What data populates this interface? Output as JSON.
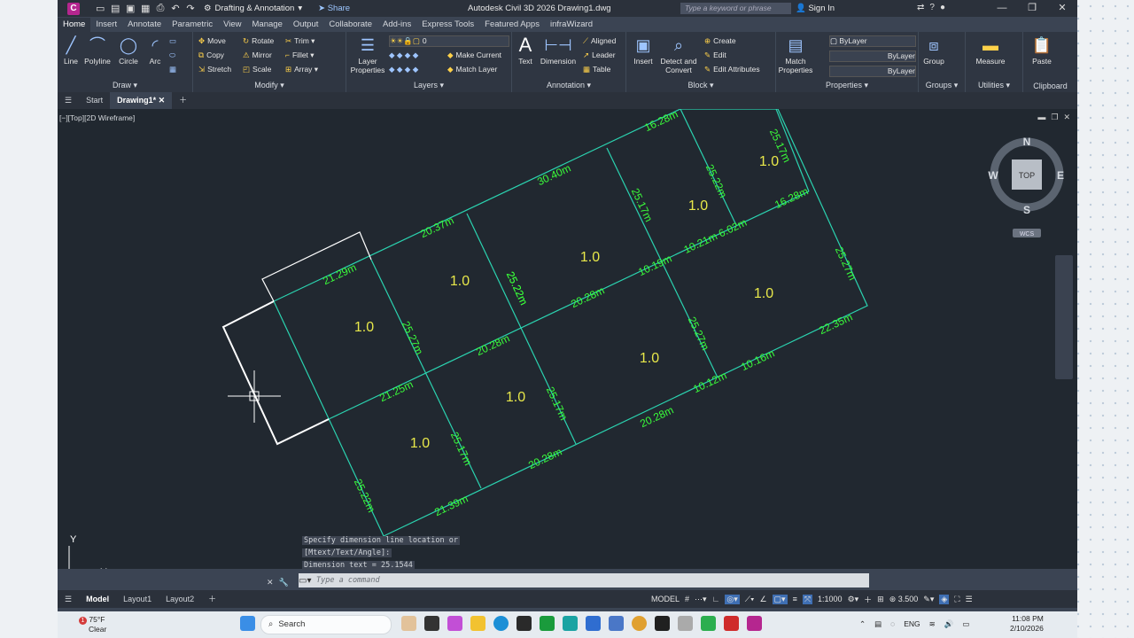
{
  "title_bar": {
    "app_logo": "C",
    "workspace": "Drafting & Annotation",
    "share": "Share",
    "title": "Autodesk Civil 3D 2026    Drawing1.dwg",
    "search_placeholder": "Type a keyword or phrase",
    "sign_in": "Sign In"
  },
  "ribbon_tabs": [
    "Home",
    "Insert",
    "Annotate",
    "Parametric",
    "View",
    "Manage",
    "Output",
    "Collaborate",
    "Add-ins",
    "Express Tools",
    "Featured Apps",
    "infraWizard"
  ],
  "ribbon": {
    "draw": {
      "label": "Draw",
      "line": "Line",
      "polyline": "Polyline",
      "circle": "Circle",
      "arc": "Arc"
    },
    "modify": {
      "label": "Modify",
      "move": "Move",
      "rotate": "Rotate",
      "trim": "Trim",
      "copy": "Copy",
      "mirror": "Mirror",
      "fillet": "Fillet",
      "stretch": "Stretch",
      "scale": "Scale",
      "array": "Array"
    },
    "layers": {
      "label": "Layers",
      "layer_properties": "Layer Properties",
      "layer_value": "0",
      "make_current": "Make Current",
      "match_layer": "Match Layer"
    },
    "annotation": {
      "label": "Annotation",
      "text": "Text",
      "dimension": "Dimension",
      "aligned": "Aligned",
      "leader": "Leader",
      "table": "Table"
    },
    "block": {
      "label": "Block",
      "insert": "Insert",
      "detect": "Detect and Convert",
      "create": "Create",
      "edit": "Edit",
      "edit_attributes": "Edit Attributes"
    },
    "properties": {
      "label": "Properties",
      "match": "Match Properties",
      "bylayer1": "ByLayer",
      "bylayer2": "ByLayer",
      "bylayer3": "ByLayer"
    },
    "groups": {
      "label": "Groups",
      "group": "Group"
    },
    "utilities": {
      "label": "Utilities",
      "measure": "Measure"
    },
    "clipboard": {
      "label": "Clipboard",
      "paste": "Paste"
    }
  },
  "doc_tabs": {
    "start": "Start",
    "drawing": "Drawing1*"
  },
  "viewport": {
    "label": "[−][Top][2D Wireframe]"
  },
  "viewcube": {
    "n": "N",
    "s": "S",
    "e": "E",
    "w": "W",
    "top": "TOP",
    "wcs": "WCS"
  },
  "drawing": {
    "lot_labels": [
      "1.0",
      "1.0",
      "1.0",
      "1.0",
      "1.0",
      "1.0",
      "1.0",
      "1.0",
      "1.0",
      "1.0"
    ],
    "dims": [
      "16.28m",
      "30.40m",
      "25.17m",
      "25.22m",
      "20.37m",
      "25.17m",
      "16.28m",
      "25.22m",
      "1.0",
      "21.29m",
      "25.22m",
      "10.21m 6.02m",
      "10.19m",
      "20.28m",
      "25.27m",
      "25.27m",
      "20.28m",
      "22.35m",
      "25.27m",
      "21.25m",
      "25.17m",
      "10.16m",
      "10.12m",
      "25.17m",
      "20.28m",
      "20.28m",
      "25.22m",
      "21.39m"
    ]
  },
  "axis": {
    "y": "Y",
    "x": "X"
  },
  "command": {
    "history": [
      "Specify dimension line location or",
      "[Mtext/Text/Angle]:",
      "Dimension text = 25.1544"
    ],
    "placeholder": "Type a command"
  },
  "status_bar": {
    "tabs": [
      "Model",
      "Layout1",
      "Layout2"
    ],
    "model": "MODEL",
    "scale": "1:1000",
    "annot_scale": "3.500"
  },
  "taskbar": {
    "weather_badge": "1",
    "temp": "75°F",
    "condition": "Clear",
    "search": "Search",
    "lang": "ENG",
    "time": "11:08 PM",
    "date": "2/10/2026"
  }
}
